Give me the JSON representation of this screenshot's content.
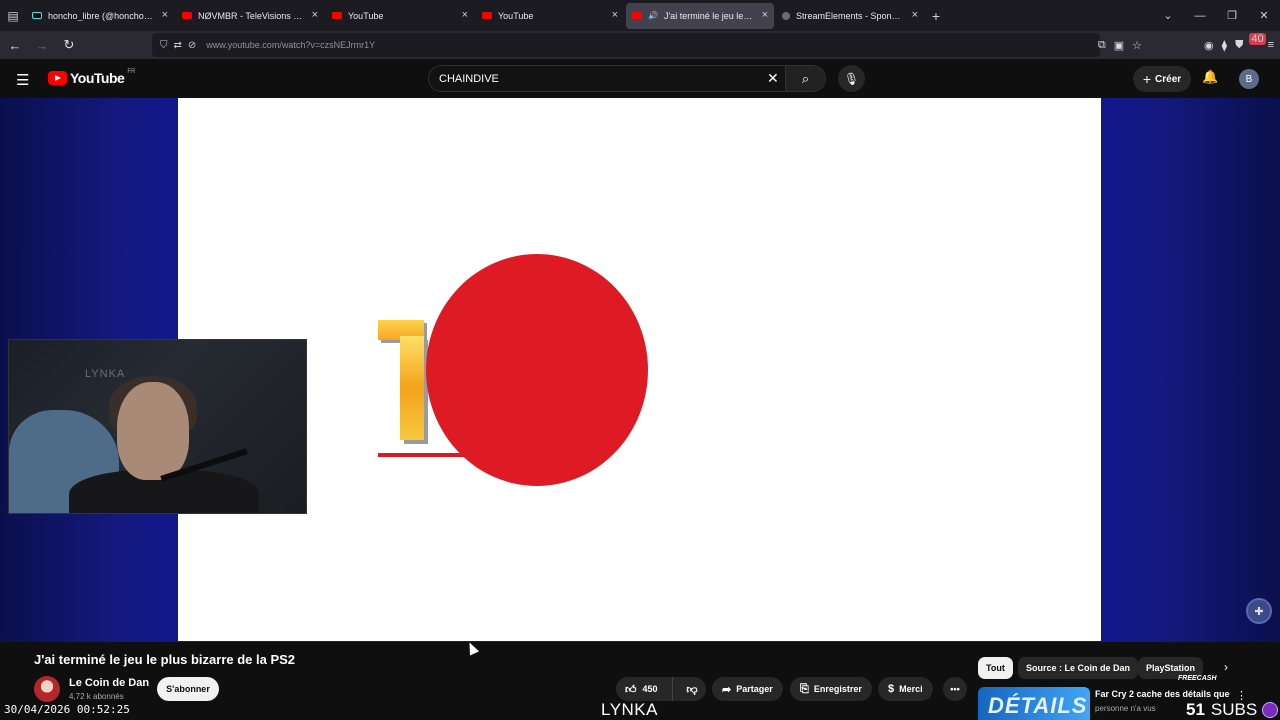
{
  "browser": {
    "tabs": [
      {
        "label": "honcho_libre (@honcho_libre) |",
        "favicon": "tiktok-icon",
        "active": false
      },
      {
        "label": "NØVMBR - TeleVisions - YouTub",
        "favicon": "youtube-icon",
        "active": false
      },
      {
        "label": "YouTube",
        "favicon": "youtube-icon",
        "active": false
      },
      {
        "label": "YouTube",
        "favicon": "youtube-icon",
        "active": false
      },
      {
        "label": "J'ai terminé le jeu le plus bi",
        "favicon": "youtube-icon",
        "active": true
      },
      {
        "label": "StreamElements - Sponsorships",
        "favicon": "streamelements-icon",
        "active": false
      }
    ],
    "url": "www.youtube.com/watch?v=czsNEJrmr1Y",
    "extension_badge": "40"
  },
  "youtube": {
    "logo_text": "YouTube",
    "region": "FR",
    "search_value": "CHAINDIVE",
    "create_label": "Créer",
    "account_initial": "B"
  },
  "video": {
    "title": "J'ai terminé le jeu le plus bizarre de la PS2",
    "webcam_text": "LYNKA",
    "channel": {
      "name": "Le Coin de Dan",
      "subscribers": "4,72 k abonnés"
    },
    "subscribe_label": "S'abonner",
    "likes": "450",
    "share_label": "Partager",
    "save_label": "Enregistrer",
    "thanks_label": "Merci"
  },
  "chips": [
    {
      "label": "Tout",
      "active": true
    },
    {
      "label": "Source : Le Coin de Dan",
      "active": false
    },
    {
      "label": "PlayStation",
      "active": false
    }
  ],
  "recommendation": {
    "thumbnail_text": "DÉTAILS",
    "title": "Far Cry 2 cache des détails que",
    "subtitle": "personne n'a vus"
  },
  "overlay": {
    "timestamp": "30/04/2026 00:52:25",
    "streamer": "LYNKA",
    "subs_count": "51",
    "subs_label": "SUBS",
    "sponsor": "FREECASH"
  },
  "colors": {
    "youtube_red": "#ff0000",
    "video_disk": "#de1b24",
    "stage_blue": "#12188a"
  }
}
